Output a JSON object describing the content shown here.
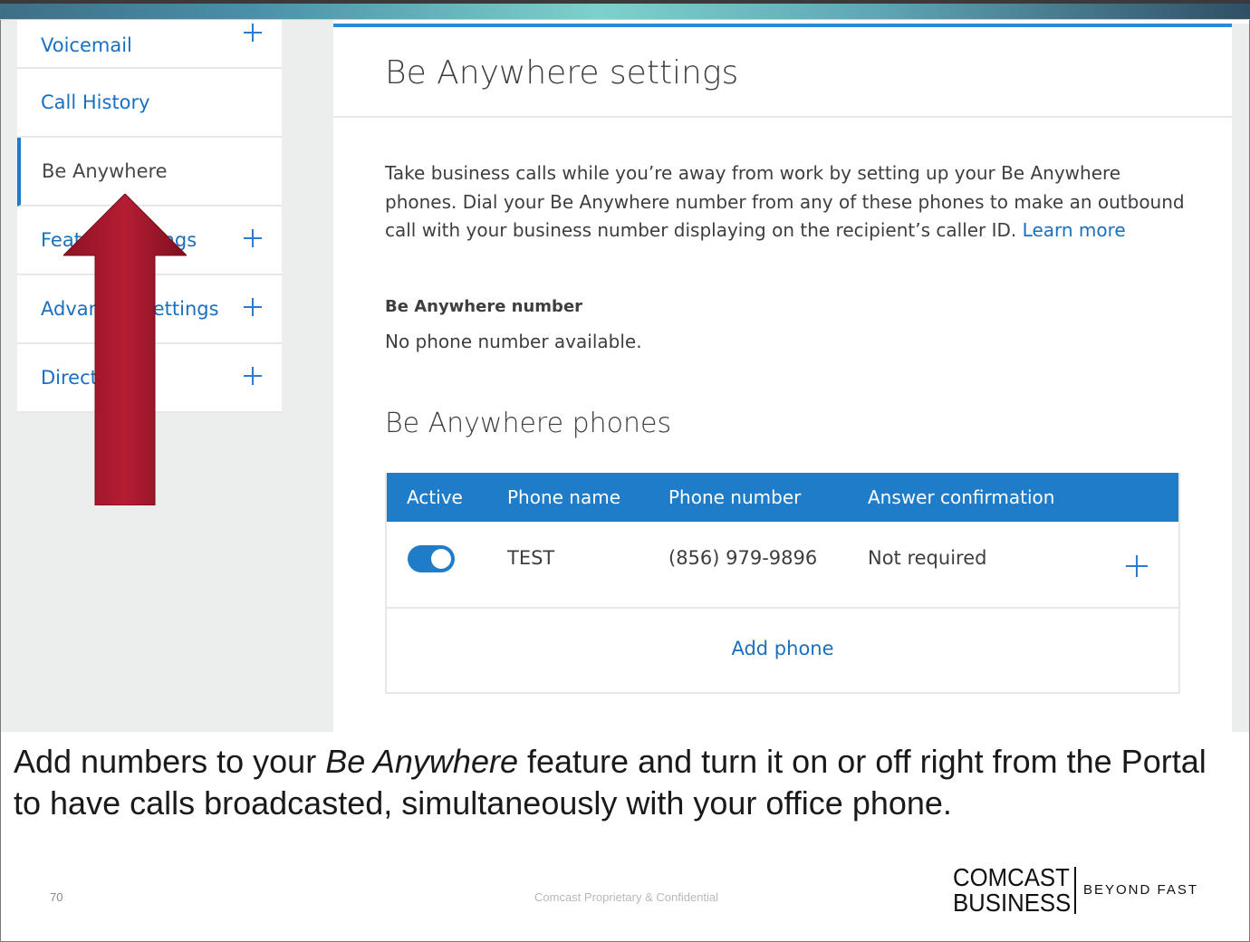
{
  "sidebar": {
    "items": [
      {
        "label": "Voicemail"
      },
      {
        "label": "Call History"
      },
      {
        "label": "Be Anywhere"
      },
      {
        "label": "Feature Settings"
      },
      {
        "label": "Advanced Settings"
      },
      {
        "label": "Directory"
      }
    ]
  },
  "main": {
    "title": "Be Anywhere settings",
    "description": "Take business calls while you’re away from work by setting up your Be Anywhere phones. Dial your Be Anywhere number from any of these phones to make an outbound call with your business number displaying on the recipient’s caller ID.",
    "learn_more": "Learn more",
    "number_label": "Be Anywhere number",
    "number_value": "No phone number available.",
    "phones_title": "Be Anywhere phones",
    "table": {
      "headers": [
        "Active",
        "Phone name",
        "Phone number",
        "Answer confirmation"
      ],
      "rows": [
        {
          "active": true,
          "name": "TEST",
          "number": "(856) 979-9896",
          "confirmation": "Not required"
        }
      ],
      "add_label": "Add phone"
    }
  },
  "caption": {
    "before": "Add numbers to your ",
    "emphasis": "Be Anywhere",
    "after": " feature and turn it on or off right from the Portal to have calls broadcasted, simultaneously with your office phone."
  },
  "footer": {
    "slide_number": "70",
    "confidential": "Comcast Proprietary & Confidential"
  },
  "logo": {
    "line1": "COMCAST",
    "line2": "BUSINESS",
    "tagline": "BEYOND FAST"
  },
  "colors": {
    "accent": "#1e7cc9",
    "link": "#1a70c0",
    "arrow": "#a3182b"
  }
}
